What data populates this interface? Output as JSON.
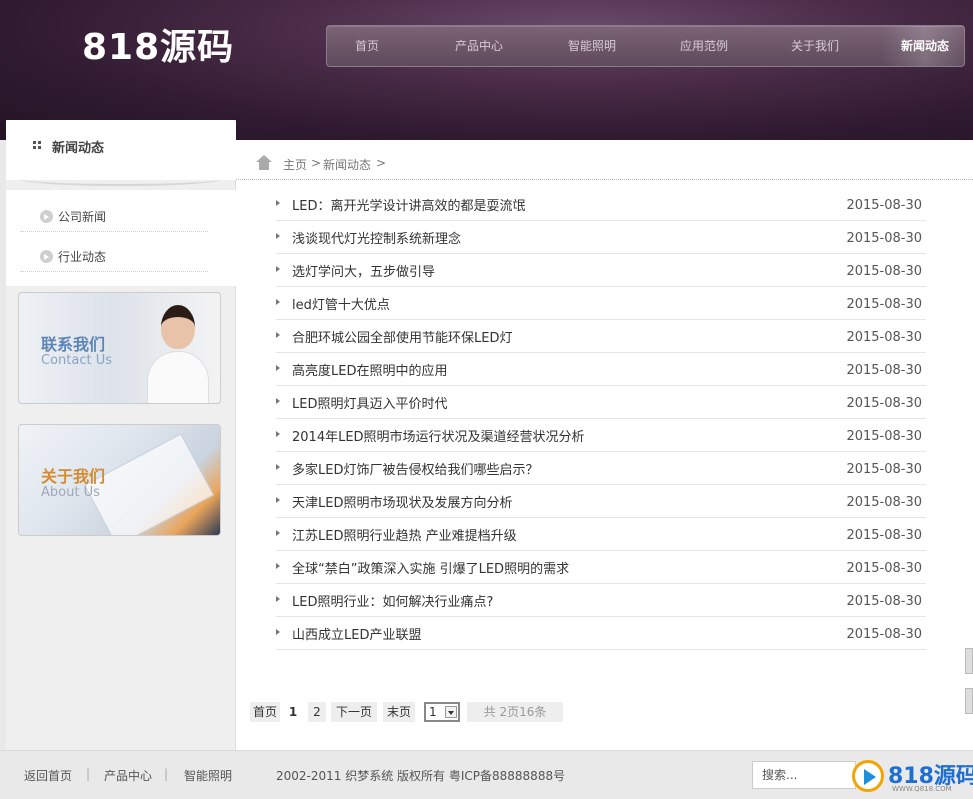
{
  "header": {
    "logo": "818源码",
    "nav": [
      {
        "label": "首页"
      },
      {
        "label": "产品中心"
      },
      {
        "label": "智能照明"
      },
      {
        "label": "应用范例"
      },
      {
        "label": "关于我们"
      },
      {
        "label": "新闻动态",
        "active": true
      }
    ]
  },
  "sidebar": {
    "title": "新闻动态",
    "items": [
      {
        "label": "公司新闻"
      },
      {
        "label": "行业动态"
      }
    ],
    "banners": [
      {
        "cn": "联系我们",
        "en": "Contact Us"
      },
      {
        "cn": "关于我们",
        "en": "About Us"
      }
    ]
  },
  "breadcrumb": {
    "home": "主页",
    "sep1": ">",
    "current": "新闻动态",
    "sep2": ">"
  },
  "news": [
    {
      "title": "LED：离开光学设计讲高效的都是耍流氓",
      "date": "2015-08-30"
    },
    {
      "title": "浅谈现代灯光控制系统新理念",
      "date": "2015-08-30"
    },
    {
      "title": "选灯学问大，五步做引导",
      "date": "2015-08-30"
    },
    {
      "title": "led灯管十大优点",
      "date": "2015-08-30"
    },
    {
      "title": "合肥环城公园全部使用节能环保LED灯",
      "date": "2015-08-30"
    },
    {
      "title": "高亮度LED在照明中的应用",
      "date": "2015-08-30"
    },
    {
      "title": "LED照明灯具迈入平价时代",
      "date": "2015-08-30"
    },
    {
      "title": "2014年LED照明市场运行状况及渠道经营状况分析",
      "date": "2015-08-30"
    },
    {
      "title": "多家LED灯饰厂被告侵权给我们哪些启示？",
      "date": "2015-08-30"
    },
    {
      "title": "天津LED照明市场现状及发展方向分析",
      "date": "2015-08-30"
    },
    {
      "title": "江苏LED照明行业趋热 产业难提档升级",
      "date": "2015-08-30"
    },
    {
      "title": "全球“禁白”政策深入实施 引爆了LED照明的需求",
      "date": "2015-08-30"
    },
    {
      "title": "LED照明行业：如何解决行业痛点?",
      "date": "2015-08-30"
    },
    {
      "title": "山西成立LED产业联盟",
      "date": "2015-08-30"
    }
  ],
  "pager": {
    "first": "首页",
    "pages": [
      "1",
      "2"
    ],
    "current": "1",
    "next": "下一页",
    "last": "末页",
    "select_value": "1",
    "total_prefix": "共",
    "total_pages": "2",
    "total_pages_suffix": "页",
    "total_items": "16",
    "total_items_suffix": "条"
  },
  "footer": {
    "links": [
      "返回首页",
      "产品中心",
      "智能照明"
    ],
    "copyright": "2002-2011 织梦系统 版权所有 粤ICP备88888888号",
    "search_placeholder": "搜索..."
  },
  "watermark": {
    "text": "818源码",
    "url": "WWW.Q818.COM"
  }
}
